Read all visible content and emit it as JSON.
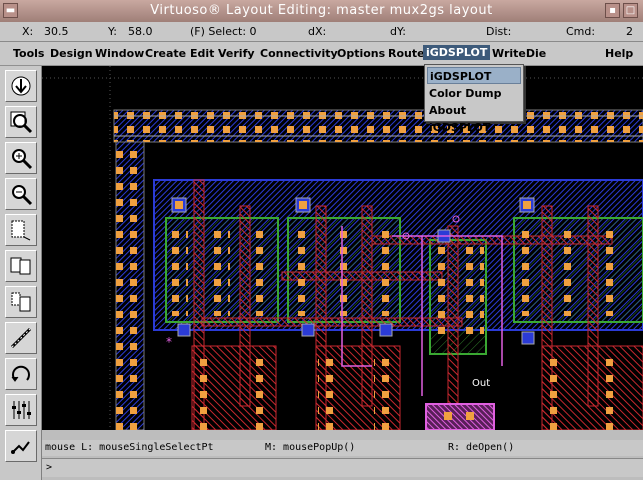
{
  "window": {
    "title": "Virtuoso® Layout Editing: master mux2gs layout"
  },
  "status": {
    "x_label": "X:",
    "x_value": "30.5",
    "y_label": "Y:",
    "y_value": "58.0",
    "select": "(F) Select: 0",
    "dx_label": "dX:",
    "dy_label": "dY:",
    "dist_label": "Dist:",
    "cmd_label": "Cmd:",
    "counter": "2"
  },
  "menubar": {
    "items": [
      "Tools",
      "Design",
      "Window",
      "Create",
      "Edit",
      "Verify",
      "Connectivity",
      "Options",
      "Route",
      "iGDSPLOT",
      "WriteDie",
      "Help"
    ],
    "active": "iGDSPLOT"
  },
  "dropdown": {
    "items": [
      "iGDSPLOT",
      "Color Dump",
      "About iGDSPLOT"
    ],
    "selected": "iGDSPLOT"
  },
  "toolbar": {
    "icons": [
      "descend-icon",
      "zoom-fit-icon",
      "zoom-in-icon",
      "zoom-out-icon",
      "stretch-icon",
      "copy-icon",
      "move-icon",
      "ruler-icon",
      "undo-icon",
      "property-icon",
      "path-icon"
    ]
  },
  "canvas": {
    "label": "Out"
  },
  "mouse": {
    "left": "mouse L: mouseSingleSelectPt",
    "middle": "M: mousePopUp()",
    "right": "R: deOpen()"
  },
  "cmdline": {
    "prompt": ">"
  },
  "colors": {
    "canvas_bg": "#000000",
    "metal": "#2b3bd6",
    "poly": "#c8282f",
    "diff": "#3aa832",
    "contact": "#f0a040"
  }
}
